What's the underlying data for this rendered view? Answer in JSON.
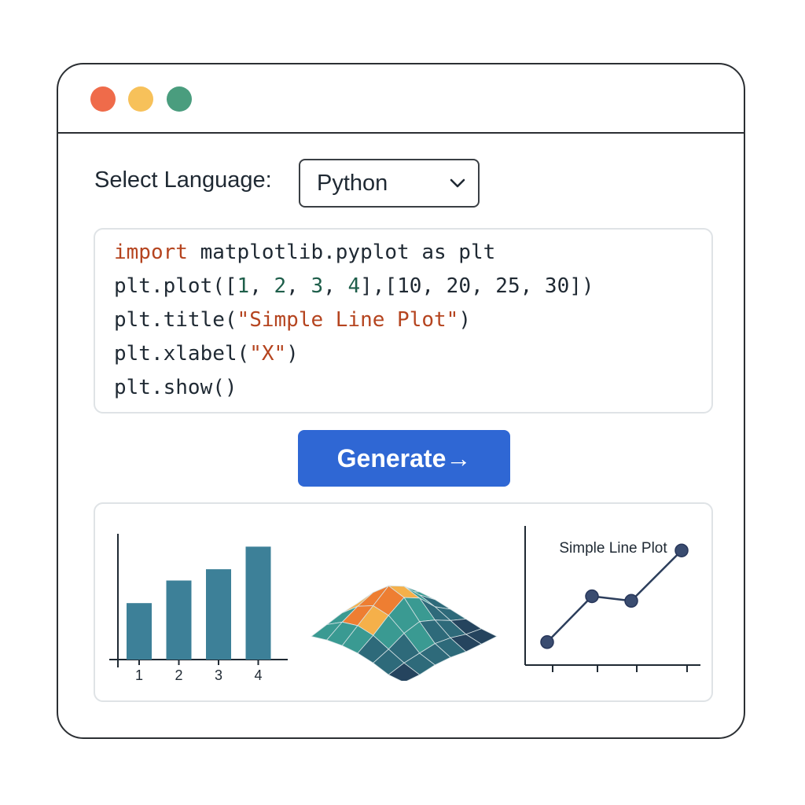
{
  "window": {
    "traffic_lights": [
      {
        "name": "close",
        "color": "#ef6b4a"
      },
      {
        "name": "minimize",
        "color": "#f7c15a"
      },
      {
        "name": "maximize",
        "color": "#4a9d7e"
      }
    ]
  },
  "language": {
    "label": "Select Language:",
    "selected": "Python",
    "chevron_icon": "chevron-down-icon"
  },
  "code": {
    "lines": [
      {
        "tokens": [
          {
            "t": "import",
            "c": "kw"
          },
          {
            "t": " matplotlib.pyplot as plt",
            "c": ""
          }
        ]
      },
      {
        "tokens": [
          {
            "t": "plt.plot([",
            "c": ""
          },
          {
            "t": "1",
            "c": "num"
          },
          {
            "t": ", ",
            "c": ""
          },
          {
            "t": "2",
            "c": "num"
          },
          {
            "t": ", ",
            "c": ""
          },
          {
            "t": "3",
            "c": "num"
          },
          {
            "t": ", ",
            "c": ""
          },
          {
            "t": "4",
            "c": "num"
          },
          {
            "t": "],[10, 20, 25, 30])",
            "c": ""
          }
        ]
      },
      {
        "tokens": [
          {
            "t": "plt.title(",
            "c": ""
          },
          {
            "t": "\"Simple Line Plot\"",
            "c": "str"
          },
          {
            "t": ")",
            "c": ""
          }
        ]
      },
      {
        "tokens": [
          {
            "t": "plt.xlabel(",
            "c": ""
          },
          {
            "t": "\"X\"",
            "c": "str"
          },
          {
            "t": ")",
            "c": ""
          }
        ]
      },
      {
        "tokens": [
          {
            "t": "plt.show()",
            "c": ""
          }
        ]
      }
    ]
  },
  "generate_button": {
    "label": "Generate",
    "arrow": "→",
    "color": "#2f67d4"
  },
  "chart_data": [
    {
      "type": "bar",
      "categories": [
        "1",
        "2",
        "3",
        "4"
      ],
      "values": [
        10,
        14,
        16,
        20
      ],
      "ylim": [
        0,
        22
      ],
      "color": "#3d8098"
    },
    {
      "type": "heatmap",
      "surface": true,
      "colors": [
        "#25445e",
        "#2e6a7a",
        "#3a9a92",
        "#f5b04a",
        "#ee7e32"
      ]
    },
    {
      "type": "line",
      "title": "Simple Line Plot",
      "x": [
        1,
        2,
        3,
        4
      ],
      "values": [
        10,
        20,
        19,
        30
      ],
      "ylim": [
        5,
        35
      ],
      "color": "#2c3e5c"
    }
  ]
}
